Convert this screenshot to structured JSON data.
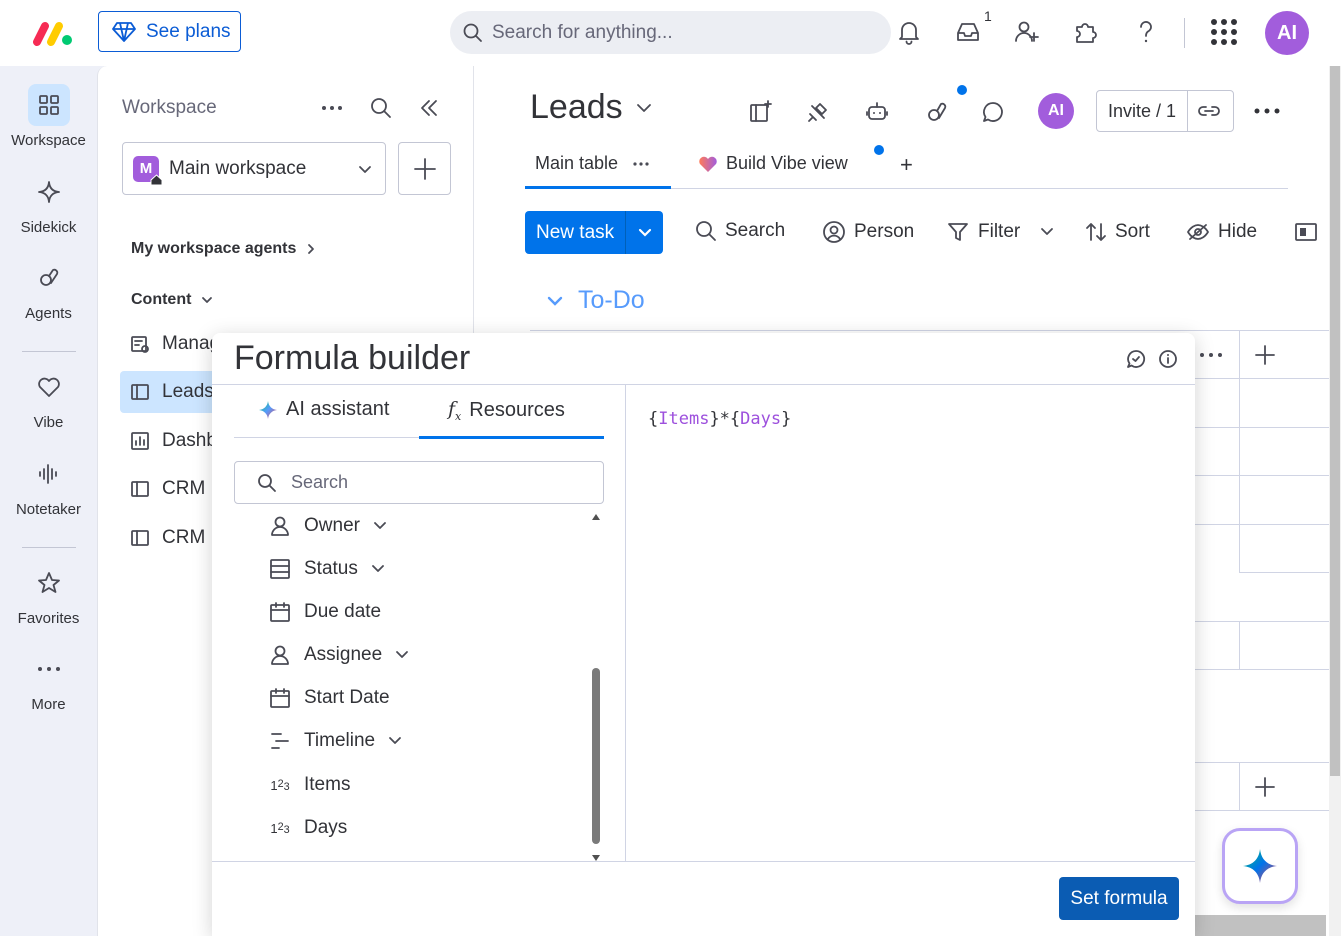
{
  "topbar": {
    "see_plans": "See plans",
    "search_placeholder": "Search for anything...",
    "inbox_count": "1",
    "avatar": "AI"
  },
  "rail": {
    "items": [
      {
        "label": "Workspace",
        "icon": "grid-icon"
      },
      {
        "label": "Sidekick",
        "icon": "sparkle-icon"
      },
      {
        "label": "Agents",
        "icon": "agents-icon"
      },
      {
        "label": "Vibe",
        "icon": "heart-icon"
      },
      {
        "label": "Notetaker",
        "icon": "waveform-icon"
      },
      {
        "label": "Favorites",
        "icon": "star-icon"
      },
      {
        "label": "More",
        "icon": "more-icon"
      }
    ]
  },
  "workspace": {
    "title": "Workspace",
    "selected": "Main workspace",
    "badge": "M",
    "agents_link": "My workspace agents",
    "content_label": "Content",
    "items": [
      {
        "label": "Manag",
        "icon": "doc-settings-icon"
      },
      {
        "label": "Leads",
        "icon": "board-icon"
      },
      {
        "label": "Dashb",
        "icon": "dashboard-icon"
      },
      {
        "label": "CRM",
        "icon": "board-icon"
      },
      {
        "label": "CRM",
        "icon": "board-icon"
      }
    ]
  },
  "board": {
    "title": "Leads",
    "avatar": "AI",
    "invite": "Invite / 1",
    "tabs": [
      {
        "label": "Main table"
      },
      {
        "label": "Build Vibe view"
      }
    ],
    "add_tab": "+",
    "new_task": "New task",
    "toolbar": {
      "search": "Search",
      "person": "Person",
      "filter": "Filter",
      "sort": "Sort",
      "hide": "Hide"
    },
    "group_title": "To-Do"
  },
  "modal": {
    "title": "Formula builder",
    "tab_ai": "AI assistant",
    "tab_resources": "Resources",
    "search_placeholder": "Search",
    "columns": [
      {
        "label": "Owner",
        "icon": "person-icon",
        "expandable": true
      },
      {
        "label": "Status",
        "icon": "status-icon",
        "expandable": true
      },
      {
        "label": "Due date",
        "icon": "calendar-icon",
        "expandable": false
      },
      {
        "label": "Assignee",
        "icon": "person-icon",
        "expandable": true
      },
      {
        "label": "Start Date",
        "icon": "calendar-icon",
        "expandable": false
      },
      {
        "label": "Timeline",
        "icon": "timeline-icon",
        "expandable": true
      },
      {
        "label": "Items",
        "icon": "numbers-icon",
        "expandable": false
      },
      {
        "label": "Days",
        "icon": "numbers-icon",
        "expandable": false
      }
    ],
    "formula": {
      "open1": "{",
      "token1": "Items",
      "mid": "}*{",
      "token2": "Days",
      "close2": "}"
    },
    "set_formula": "Set formula"
  },
  "colors": {
    "primary": "#0073ea",
    "avatar": "#a25ddc",
    "group": "#579bfc",
    "formula_token": "#9d50dd"
  }
}
